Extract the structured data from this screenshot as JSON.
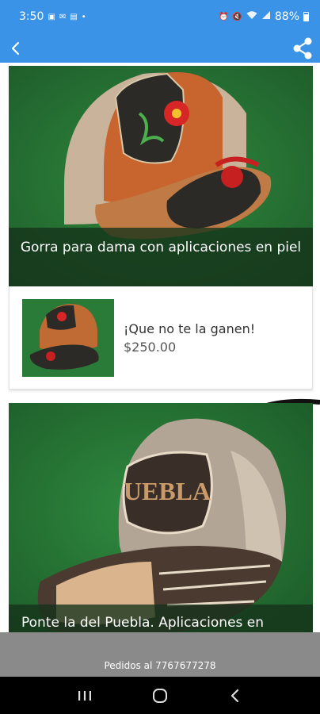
{
  "status_bar": {
    "time": "3:50",
    "battery": "88%",
    "icons": [
      "image-icon",
      "mail-icon",
      "news-icon",
      "dot-icon",
      "alarm-icon",
      "mute-icon",
      "wifi-icon",
      "signal-icon",
      "battery-icon"
    ]
  },
  "app_bar": {
    "back_icon": "chevron-left-icon",
    "share_icon": "share-icon",
    "color": "#3a93e6"
  },
  "products": [
    {
      "caption": "Gorra para dama con aplicaciones en piel"
    },
    {
      "caption": "Ponte la del Puebla. Aplicaciones en",
      "patch_text": "UEBLA"
    }
  ],
  "offer": {
    "title": "¡Que no te la ganen!",
    "price": "$250.00"
  },
  "footer": {
    "text": "Pedidos al 7767677278"
  },
  "nav_bar": {
    "icons": [
      "recents-icon",
      "home-icon",
      "back-icon"
    ]
  }
}
